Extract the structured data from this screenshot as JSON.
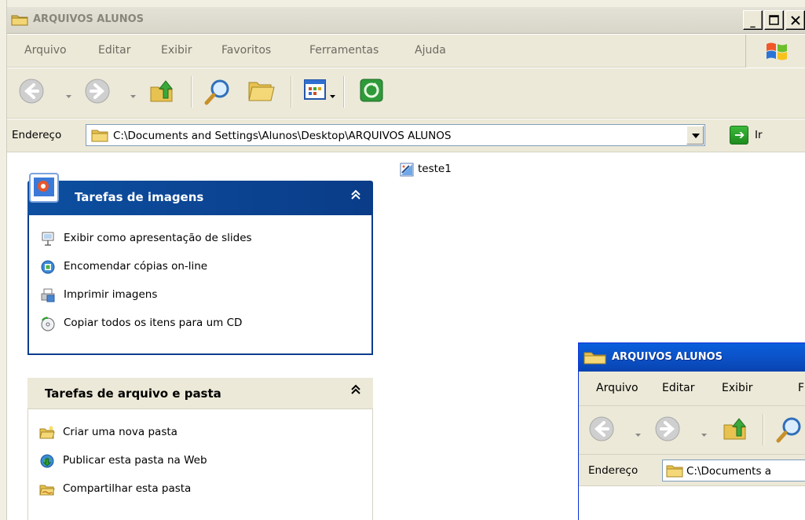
{
  "window": {
    "title": "ARQUIVOS ALUNOS",
    "buttons": [
      "minimize",
      "maximize",
      "close"
    ]
  },
  "menubar": {
    "items": [
      "Arquivo",
      "Editar",
      "Exibir",
      "Favoritos",
      "Ferramentas",
      "Ajuda"
    ]
  },
  "toolbar": {
    "buttons": [
      "back-icon",
      "forward-icon",
      "folder-up-icon",
      "search-icon",
      "folders-icon",
      "views-icon",
      "sync-icon"
    ]
  },
  "address": {
    "label": "Endereço",
    "value": "C:\\Documents and Settings\\Alunos\\Desktop\\ARQUIVOS ALUNOS",
    "go_label": "Ir"
  },
  "image_tasks": {
    "title": "Tarefas de imagens",
    "items": [
      {
        "label": "Exibir como apresentação de slides",
        "icon": "slideshow-icon"
      },
      {
        "label": "Encomendar cópias on-line",
        "icon": "order-prints-icon"
      },
      {
        "label": "Imprimir imagens",
        "icon": "print-pictures-icon"
      },
      {
        "label": "Copiar todos os itens para um CD",
        "icon": "copy-to-cd-icon"
      }
    ]
  },
  "file_tasks": {
    "title": "Tarefas de arquivo e pasta",
    "items": [
      {
        "label": "Criar uma nova pasta",
        "icon": "new-folder-icon"
      },
      {
        "label": "Publicar esta pasta na Web",
        "icon": "publish-web-icon"
      },
      {
        "label": "Compartilhar esta pasta",
        "icon": "share-folder-icon"
      }
    ]
  },
  "files": [
    {
      "name": "teste1",
      "icon": "bitmap-file-icon"
    }
  ],
  "second_window": {
    "title": "ARQUIVOS ALUNOS",
    "menu": [
      "Arquivo",
      "Editar",
      "Exibir",
      "F"
    ],
    "address_label": "Endereço",
    "address_value": "C:\\Documents a"
  }
}
